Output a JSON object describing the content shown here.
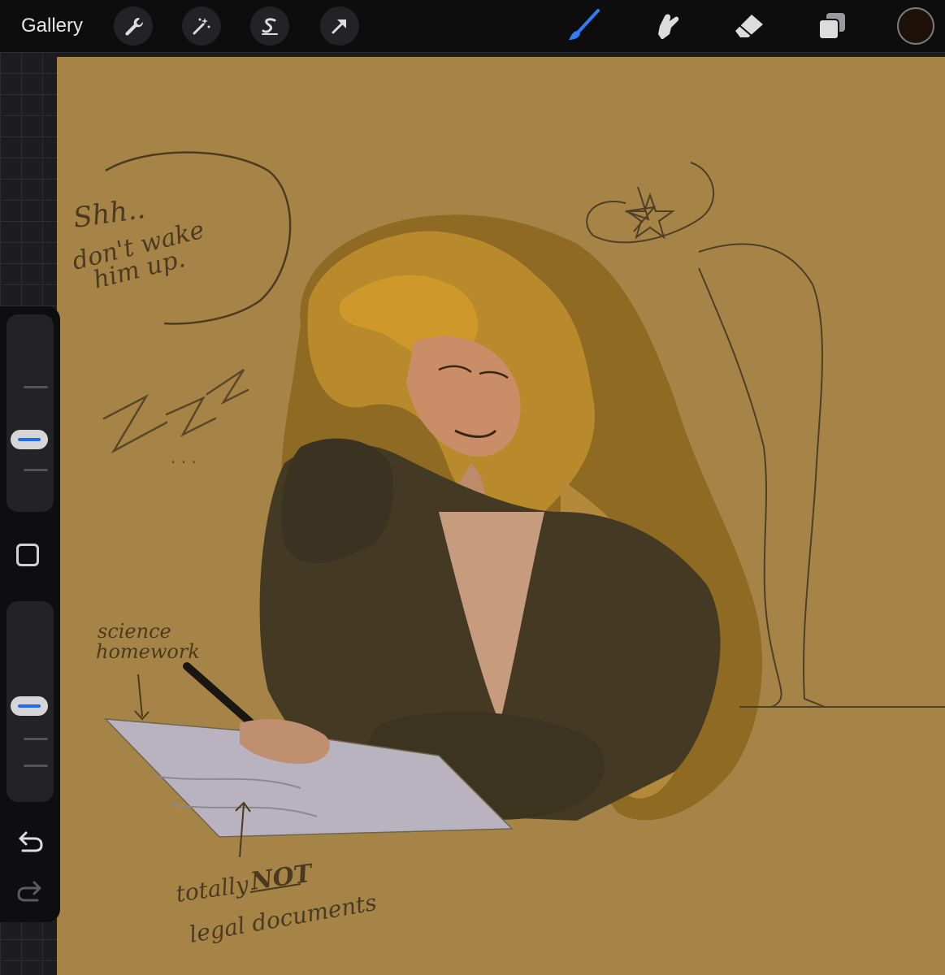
{
  "toolbar": {
    "gallery_label": "Gallery",
    "left_tools": [
      "wrench-icon",
      "magic-wand-icon",
      "selection-s-icon",
      "transform-arrow-icon"
    ],
    "right_tools": [
      "brush-icon",
      "smudge-icon",
      "eraser-icon",
      "layers-icon"
    ],
    "active_tool": "brush",
    "active_color": "#1e1208",
    "accent": "#2f7df6"
  },
  "sidebar": {
    "brush_size_slider": "brush-size",
    "opacity_slider": "opacity",
    "modify_button": "square",
    "undo": "undo-icon",
    "redo": "redo-icon"
  },
  "canvas": {
    "background": "#a68447",
    "notes": {
      "speech_line1": "Shh..",
      "speech_line2": "don't wake",
      "speech_line3": "him up.",
      "zzz": "Z Z Z",
      "dots": ". . .",
      "science_line1": "science",
      "science_line2": "homework",
      "totally": "totally",
      "not": "NOT",
      "legal": "legal documents"
    }
  }
}
